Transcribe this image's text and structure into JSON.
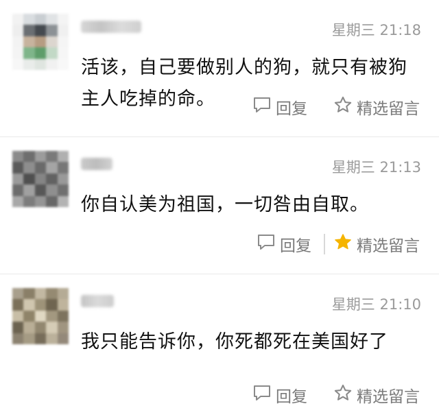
{
  "comments": [
    {
      "time": "星期三 21:18",
      "text_line1": "活该，自己要做别人的狗，就只有被狗",
      "text_line2": "主人吃掉的命。",
      "reply_label": "回复",
      "feature_label": "精选留言",
      "featured": false
    },
    {
      "time": "星期三 21:13",
      "text_line1": "你自认美为祖国，一切咎由自取。",
      "text_line2": "",
      "reply_label": "回复",
      "feature_label": "精选留言",
      "featured": true
    },
    {
      "time": "星期三 21:10",
      "text_line1": "我只能告诉你，你死都死在美国好了",
      "text_line2": "",
      "reply_label": "回复",
      "feature_label": "精选留言",
      "featured": false
    }
  ],
  "colors": {
    "star_featured": "#f5b400",
    "star_outline": "#8a8a8a",
    "meta_text": "#9a9a9a"
  }
}
